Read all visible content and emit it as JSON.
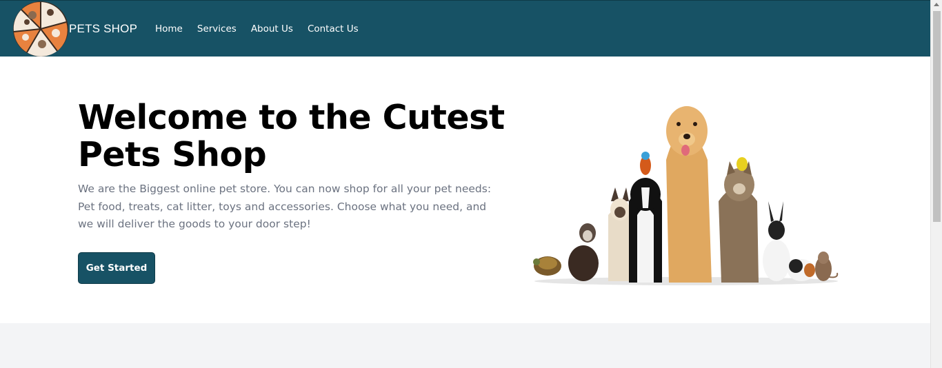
{
  "navbar": {
    "brand": "PETS SHOP",
    "links": [
      "Home",
      "Services",
      "About Us",
      "Contact Us"
    ],
    "background": "#175265"
  },
  "hero": {
    "title": "Welcome to the Cutest Pets Shop",
    "description": "We are the Biggest online pet store. You can now shop for all your pet needs: Pet food, treats, cat litter, toys and accessories. Choose what you need, and we will deliver the goods to your door step!",
    "cta_label": "Get Started",
    "image_icon": "pets-group-photo"
  },
  "colors": {
    "accent": "#175265",
    "footer_bg": "#f3f4f6",
    "text_muted": "#6b7280"
  }
}
